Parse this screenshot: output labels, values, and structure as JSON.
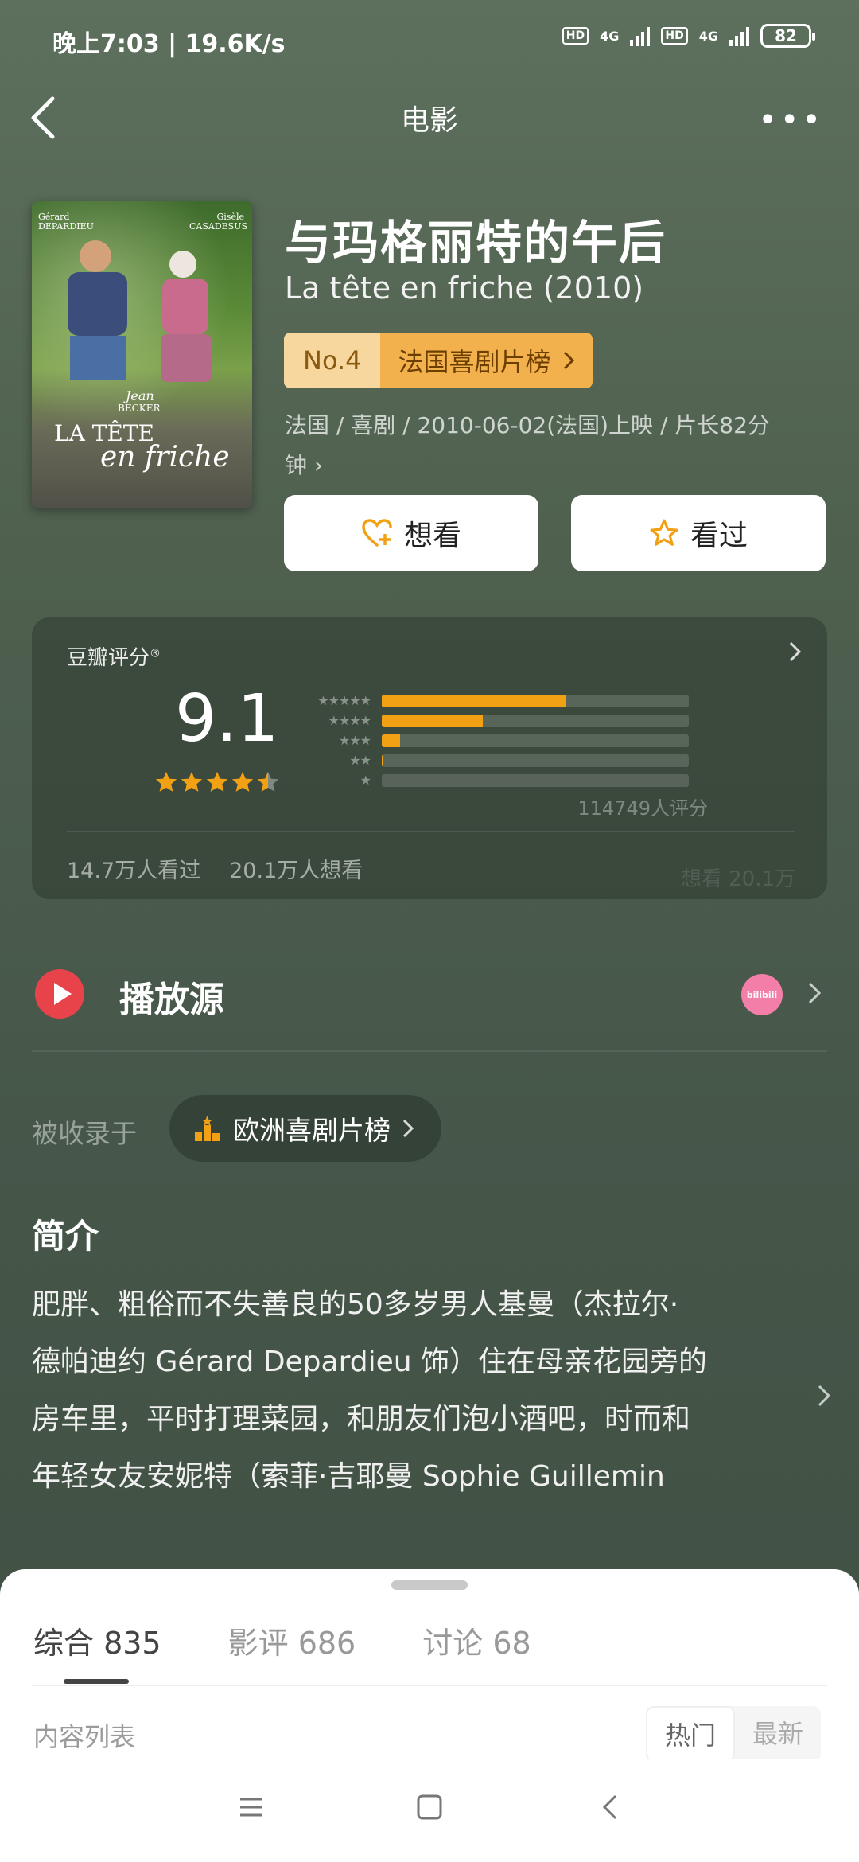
{
  "status": {
    "time": "晚上7:03 | 19.6K/s",
    "battery": "82",
    "hd": "HD",
    "net": "4G"
  },
  "header": {
    "title": "电影"
  },
  "movie": {
    "title": "与玛格丽特的午后",
    "subtitle": "La tête en friche (2010)",
    "rank_no": "No.4",
    "rank_name": "法国喜剧片榜",
    "meta_line1": "法国 / 喜剧 / 2010-06-02(法国)上映 / 片长82分",
    "meta_line2": "钟 ›",
    "poster": {
      "actor_left_first": "Gérard",
      "actor_left_last": "DEPARDIEU",
      "actor_right_first": "Gisèle",
      "actor_right_last": "CASADESUS",
      "director_first": "Jean",
      "director_last": "BECKER",
      "title_big": "LA TÊTE",
      "title_script": "en friche"
    }
  },
  "actions": {
    "want": "想看",
    "seen": "看过"
  },
  "rating": {
    "label": "豆瓣评分",
    "reg": "®",
    "score": "9.1",
    "stars_value": 4.5,
    "distribution": [
      {
        "stars": "★★★★★",
        "percent": 60
      },
      {
        "stars": "★★★★",
        "percent": 33
      },
      {
        "stars": "★★★",
        "percent": 6
      },
      {
        "stars": "★★",
        "percent": 0.5
      },
      {
        "stars": "★",
        "percent": 0
      }
    ],
    "count": "114749人评分",
    "watched": "14.7万人看过",
    "want": "20.1万人想看",
    "watermark": "想看 20.1万"
  },
  "play": {
    "label": "播放源",
    "provider": "bilibili"
  },
  "collected": {
    "label": "被收录于",
    "list": "欧洲喜剧片榜"
  },
  "intro": {
    "title": "简介",
    "lines": [
      "肥胖、粗俗而不失善良的50多岁男人基曼（杰拉尔·",
      "德帕迪约 Gérard Depardieu 饰）住在母亲花园旁的",
      "房车里，平时打理菜园，和朋友们泡小酒吧，时而和",
      "年轻女友安妮特（索菲·吉耶曼 Sophie Guillemin"
    ]
  },
  "sheet": {
    "tabs": [
      {
        "label": "综合 835"
      },
      {
        "label": "影评 686"
      },
      {
        "label": "讨论 68"
      }
    ],
    "list_label": "内容列表",
    "sort_hot": "热门",
    "sort_new": "最新"
  },
  "colors": {
    "accent": "#f2a114",
    "play_red": "#e8434a",
    "rank_bg": "#f3b14d"
  }
}
